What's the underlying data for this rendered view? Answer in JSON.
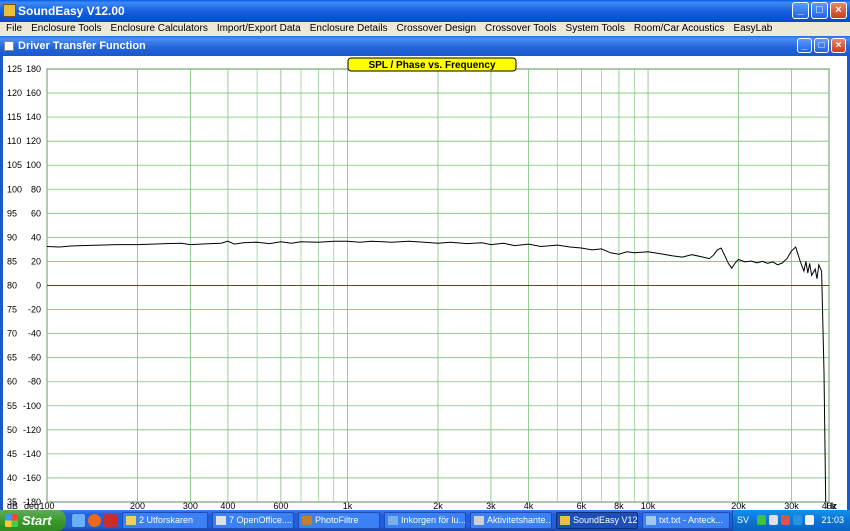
{
  "app": {
    "title": "SoundEasy V12.00",
    "minimize": "_",
    "maximize": "□",
    "close": "×"
  },
  "menu": {
    "items": [
      "File",
      "Enclosure Tools",
      "Enclosure Calculators",
      "Import/Export Data",
      "Enclosure Details",
      "Crossover Design",
      "Crossover Tools",
      "System Tools",
      "Room/Car Acoustics",
      "EasyLab"
    ]
  },
  "child_window": {
    "title": "Driver Transfer Function"
  },
  "chart_data": {
    "type": "line",
    "title": "SPL / Phase vs. Frequency",
    "x_scale": "log",
    "xlim": [
      100,
      40000
    ],
    "x_unit": "Hz",
    "x_ticks": [
      {
        "v": 100,
        "l": "100"
      },
      {
        "v": 200,
        "l": "200"
      },
      {
        "v": 300,
        "l": "300"
      },
      {
        "v": 400,
        "l": "400"
      },
      {
        "v": 600,
        "l": "600"
      },
      {
        "v": 1000,
        "l": "1k"
      },
      {
        "v": 2000,
        "l": "2k"
      },
      {
        "v": 3000,
        "l": "3k"
      },
      {
        "v": 4000,
        "l": "4k"
      },
      {
        "v": 6000,
        "l": "6k"
      },
      {
        "v": 8000,
        "l": "8k"
      },
      {
        "v": 10000,
        "l": "10k"
      },
      {
        "v": 20000,
        "l": "20k"
      },
      {
        "v": 30000,
        "l": "30k"
      },
      {
        "v": 40000,
        "l": "40k"
      }
    ],
    "minor_grid": [
      500,
      700,
      800,
      900,
      5000,
      7000,
      9000
    ],
    "y_db_unit": "dB",
    "y_deg_unit": "deg",
    "ylim_db": [
      35,
      125
    ],
    "ylim_deg": [
      -180,
      180
    ],
    "y_db_ticks": [
      125,
      120,
      115,
      110,
      105,
      100,
      95,
      90,
      85,
      80,
      75,
      70,
      65,
      60,
      55,
      50,
      45,
      40,
      35
    ],
    "y_deg_ticks": [
      180,
      160,
      140,
      120,
      100,
      80,
      60,
      40,
      20,
      0,
      -20,
      -40,
      -60,
      -80,
      -100,
      -120,
      -140,
      -160,
      -180
    ],
    "grid": true,
    "colors": {
      "grid": "#7cc07c",
      "zero_line": "#b02020",
      "curve": "#000000",
      "title_box": "#ffff00"
    },
    "series": [
      {
        "zero_phase_line_deg": 0,
        "points": [
          [
            100,
            88.1
          ],
          [
            110,
            88.0
          ],
          [
            120,
            88.2
          ],
          [
            130,
            88.3
          ],
          [
            150,
            88.4
          ],
          [
            170,
            88.5
          ],
          [
            200,
            88.5
          ],
          [
            250,
            88.7
          ],
          [
            280,
            88.8
          ],
          [
            300,
            88.5
          ],
          [
            350,
            88.7
          ],
          [
            380,
            88.8
          ],
          [
            400,
            89.2
          ],
          [
            420,
            88.6
          ],
          [
            450,
            88.9
          ],
          [
            500,
            89.0
          ],
          [
            550,
            88.7
          ],
          [
            600,
            89.1
          ],
          [
            650,
            88.8
          ],
          [
            700,
            89.1
          ],
          [
            800,
            89.0
          ],
          [
            900,
            89.2
          ],
          [
            1000,
            89.2
          ],
          [
            1100,
            89.0
          ],
          [
            1200,
            89.2
          ],
          [
            1400,
            89.0
          ],
          [
            1600,
            89.2
          ],
          [
            1800,
            89.0
          ],
          [
            2000,
            88.8
          ],
          [
            2200,
            89.0
          ],
          [
            2500,
            88.7
          ],
          [
            2800,
            88.9
          ],
          [
            3000,
            88.5
          ],
          [
            3300,
            88.8
          ],
          [
            3600,
            88.3
          ],
          [
            4000,
            88.6
          ],
          [
            4400,
            88.1
          ],
          [
            5000,
            88.4
          ],
          [
            5500,
            88.0
          ],
          [
            6000,
            87.8
          ],
          [
            6500,
            87.4
          ],
          [
            7000,
            87.6
          ],
          [
            7500,
            86.8
          ],
          [
            8000,
            86.5
          ],
          [
            8500,
            87.0
          ],
          [
            9000,
            86.8
          ],
          [
            10000,
            87.0
          ],
          [
            11000,
            86.6
          ],
          [
            12000,
            86.2
          ],
          [
            13000,
            85.9
          ],
          [
            14000,
            86.4
          ],
          [
            15000,
            86.0
          ],
          [
            16000,
            85.6
          ],
          [
            16500,
            86.3
          ],
          [
            17000,
            87.4
          ],
          [
            17500,
            87.8
          ],
          [
            18000,
            86.2
          ],
          [
            18500,
            84.6
          ],
          [
            19000,
            83.6
          ],
          [
            19500,
            84.7
          ],
          [
            20000,
            85.4
          ],
          [
            21000,
            84.9
          ],
          [
            22000,
            85.1
          ],
          [
            23000,
            84.7
          ],
          [
            24000,
            85.0
          ],
          [
            25000,
            84.6
          ],
          [
            26000,
            84.9
          ],
          [
            27000,
            84.3
          ],
          [
            28000,
            84.7
          ],
          [
            29000,
            85.6
          ],
          [
            30000,
            87.2
          ],
          [
            31000,
            88.0
          ],
          [
            32000,
            85.2
          ],
          [
            33000,
            83.0
          ],
          [
            33500,
            85.0
          ],
          [
            34000,
            82.6
          ],
          [
            34500,
            84.6
          ],
          [
            35000,
            82.1
          ],
          [
            36000,
            83.4
          ],
          [
            36500,
            81.4
          ],
          [
            37000,
            84.3
          ],
          [
            37800,
            83.0
          ],
          [
            38500,
            62.0
          ],
          [
            39000,
            35.0
          ]
        ]
      }
    ]
  },
  "taskbar": {
    "start_label": "Start",
    "tasks": [
      {
        "label": "2 Utforskaren",
        "active": false
      },
      {
        "label": "7 OpenOffice....",
        "active": false
      },
      {
        "label": "PhotoFiltre",
        "active": false
      },
      {
        "label": "Inkorgen för lu...",
        "active": false
      },
      {
        "label": "Aktivitetshante...",
        "active": false
      },
      {
        "label": "SoundEasy V12...",
        "active": true
      },
      {
        "label": "txt.txt - Anteck...",
        "active": false
      }
    ],
    "tray": {
      "lang": "SV",
      "clock": "21:03"
    }
  }
}
